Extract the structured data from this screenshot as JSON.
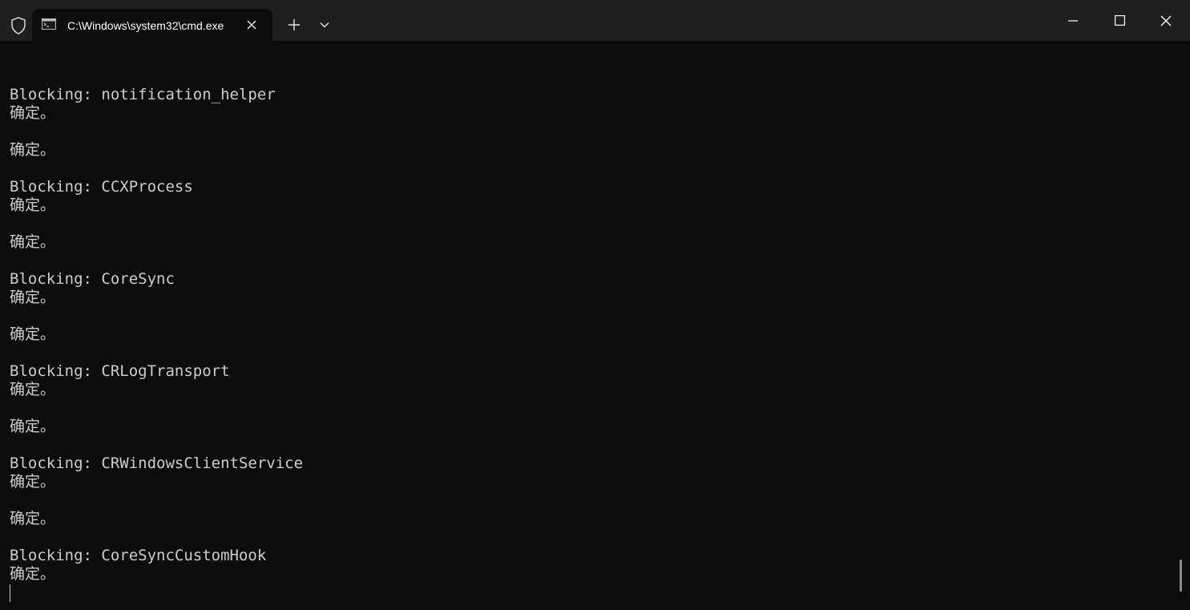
{
  "window": {
    "tab_title": "C:\\Windows\\system32\\cmd.exe"
  },
  "icons": {
    "shield": "shield-icon",
    "tab": "console-icon",
    "tab_close": "close-icon",
    "new_tab": "plus-icon",
    "dropdown": "chevron-down-icon",
    "minimize": "minimize-icon",
    "maximize": "maximize-icon",
    "close": "close-icon"
  },
  "colors": {
    "titlebar": "#1f1f1f",
    "console_bg": "#0c0c0c",
    "text": "#cccccc"
  },
  "console": {
    "lines": [
      "",
      "Blocking: notification_helper",
      "确定。",
      "",
      "确定。",
      "",
      "Blocking: CCXProcess",
      "确定。",
      "",
      "确定。",
      "",
      "Blocking: CoreSync",
      "确定。",
      "",
      "确定。",
      "",
      "Blocking: CRLogTransport",
      "确定。",
      "",
      "确定。",
      "",
      "Blocking: CRWindowsClientService",
      "确定。",
      "",
      "确定。",
      "",
      "Blocking: CoreSyncCustomHook",
      "确定。"
    ]
  }
}
